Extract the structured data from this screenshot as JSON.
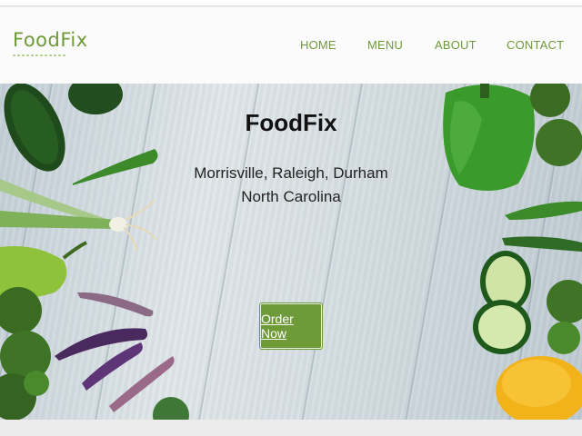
{
  "brand": {
    "name": "FoodFix",
    "accent": "#6f9a3a"
  },
  "nav": {
    "items": [
      {
        "label": "HOME"
      },
      {
        "label": "MENU"
      },
      {
        "label": "ABOUT"
      },
      {
        "label": "CONTACT"
      }
    ]
  },
  "hero": {
    "title": "FoodFix",
    "location_line1": "Morrisville, Raleigh, Durham",
    "location_line2": "North Carolina",
    "cta_label": "Order Now",
    "background": "vegetables on wooden table"
  }
}
